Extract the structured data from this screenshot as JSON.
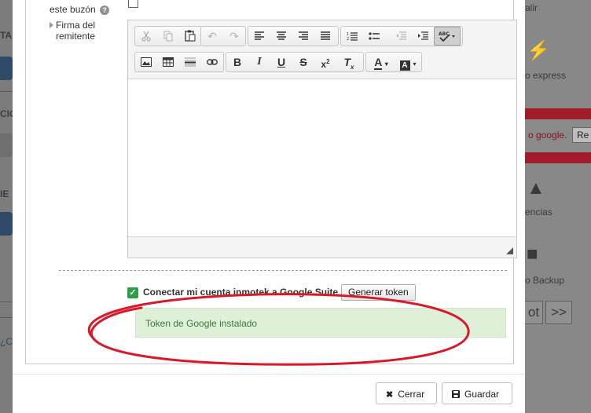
{
  "background": {
    "left_fragments": [
      "TA",
      "CIC",
      "IE",
      "¿C"
    ],
    "right_labels": [
      "alir",
      "o express",
      "encias",
      "o Backup"
    ],
    "alert_text": "o google.",
    "alert_button": "Re",
    "pager_prev": "ot",
    "pager_next": ">>"
  },
  "form": {
    "mailbox_label": "este buzón",
    "help_icon_glyph": "?",
    "signature_label": "Firma del remitente"
  },
  "editor_toolbar": {
    "row1": [
      "cut-icon",
      "copy-icon",
      "paste-icon",
      "undo-icon",
      "redo-icon",
      "align-left-icon",
      "align-center-icon",
      "align-right-icon",
      "align-justify-icon",
      "numbered-list-icon",
      "bulleted-list-icon",
      "outdent-icon",
      "indent-icon",
      "spellcheck-icon"
    ],
    "row2": [
      "image-icon",
      "table-icon",
      "horizontal-line-icon",
      "link-icon",
      "bold-icon",
      "italic-icon",
      "underline-icon",
      "strikethrough-icon",
      "superscript-icon",
      "remove-format-icon",
      "text-color-icon",
      "background-color-icon"
    ]
  },
  "google": {
    "checked": true,
    "label": "Conectar mi cuenta inmotek a Google Suite",
    "button": "Generar token",
    "success_message": "Token de Google instalado"
  },
  "footer": {
    "close_label": "Cerrar",
    "save_label": "Guardar"
  },
  "colors": {
    "success_bg": "#dff0d8",
    "success_text": "#3c763d",
    "check_green": "#2e9e44",
    "annotation_red": "#d8192a"
  }
}
